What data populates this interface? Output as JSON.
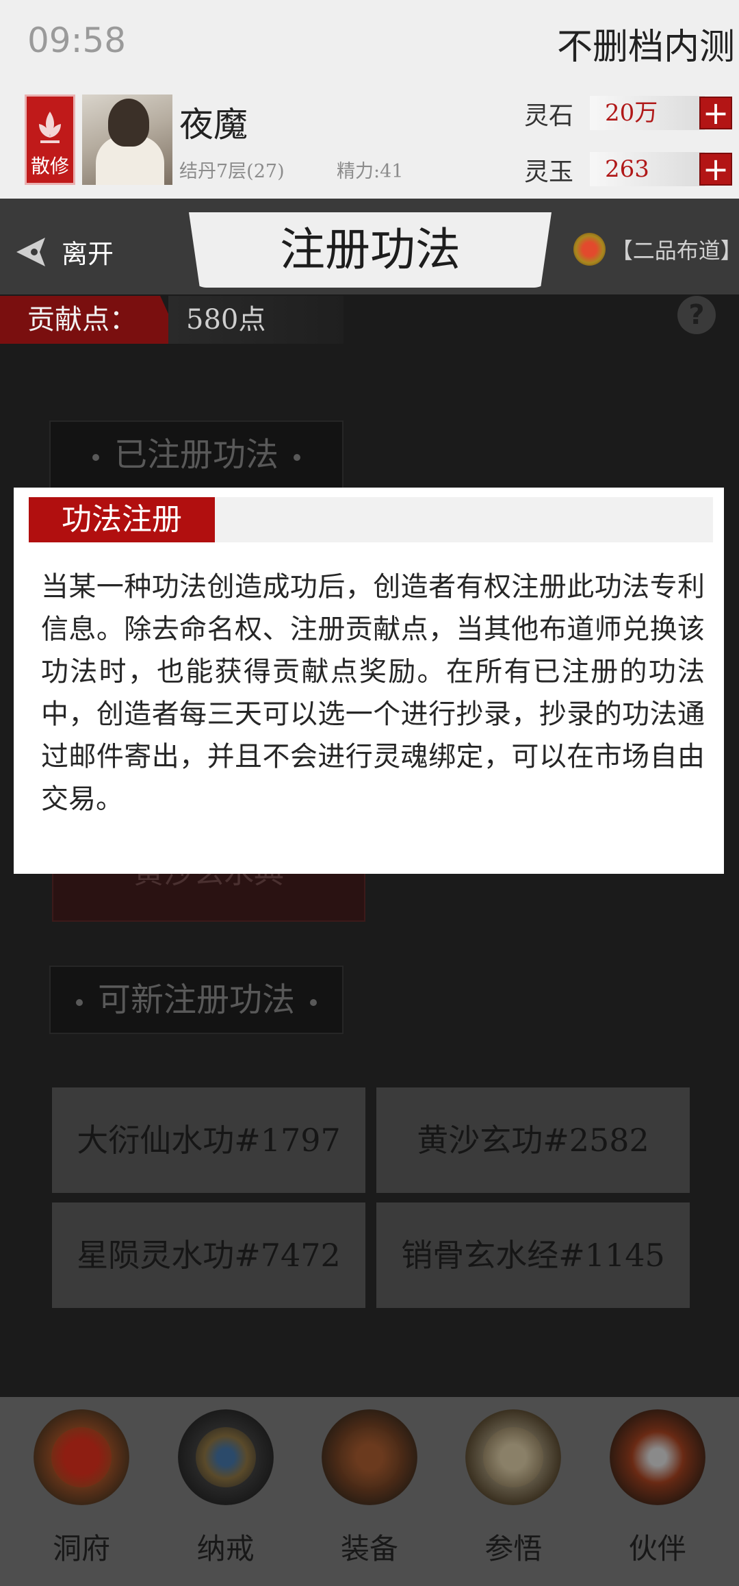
{
  "status_bar": {
    "time": "09:58",
    "test_label": "不删档内测"
  },
  "player": {
    "sect_badge": "散修",
    "name": "夜魔",
    "level": "结丹7层(27)",
    "energy": "精力:41"
  },
  "currencies": [
    {
      "label": "灵石",
      "value": "20万",
      "icon": "plus-icon"
    },
    {
      "label": "灵玉",
      "value": "263",
      "icon": "plus-icon"
    }
  ],
  "title_bar": {
    "leave_label": "离开",
    "title": "注册功法",
    "rank": "【二品布道】"
  },
  "contribution": {
    "label": "贡献点：",
    "value": "580点",
    "help": "?"
  },
  "sections": {
    "registered_header": "已注册功法",
    "registered_items": [
      "黄沙玄水典"
    ],
    "new_header": "可新注册功法",
    "new_items": [
      "大衍仙水功#1797",
      "黄沙玄功#2582",
      "星陨灵水功#7472",
      "销骨玄水经#1145"
    ]
  },
  "bottom_nav": [
    {
      "label": "洞府",
      "icon": "cave-mansion-icon"
    },
    {
      "label": "纳戒",
      "icon": "storage-ring-icon"
    },
    {
      "label": "装备",
      "icon": "equipment-icon"
    },
    {
      "label": "参悟",
      "icon": "scroll-icon"
    },
    {
      "label": "伙伴",
      "icon": "companion-icon"
    }
  ],
  "modal": {
    "title": "功法注册",
    "body": "当某一种功法创造成功后，创造者有权注册此功法专利信息。除去命名权、注册贡献点，当其他布道师兑换该功法时，也能获得贡献点奖励。在所有已注册的功法中，创造者每三天可以选一个进行抄录，抄录的功法通过邮件寄出，并且不会进行灵魂绑定，可以在市场自由交易。"
  },
  "colors": {
    "accent_red": "#b10f0f",
    "overlay": "#1b1b1b"
  }
}
